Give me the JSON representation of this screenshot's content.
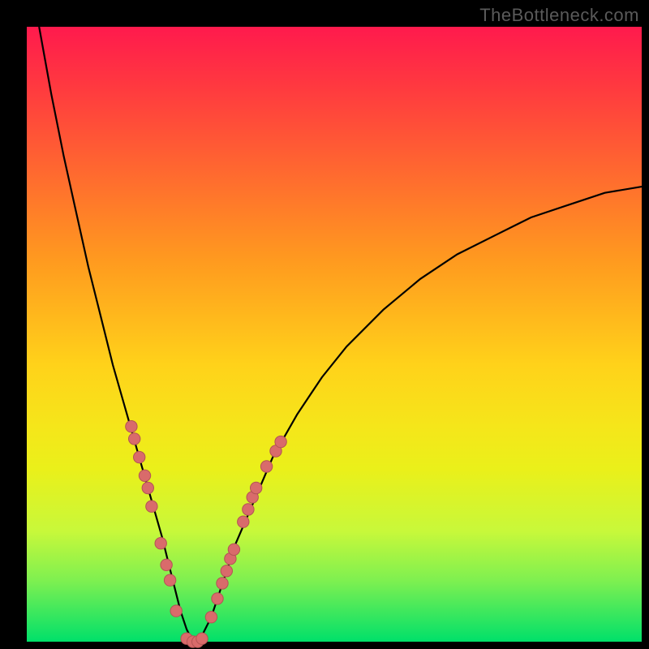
{
  "watermark": "TheBottleneck.com",
  "colors": {
    "curve": "#000000",
    "marker_fill": "#d96b6b",
    "marker_stroke": "#b35454",
    "bg_black": "#000000"
  },
  "chart_data": {
    "type": "line",
    "title": "",
    "xlabel": "",
    "ylabel": "",
    "xlim": [
      0,
      100
    ],
    "ylim": [
      0,
      100
    ],
    "series": [
      {
        "name": "bottleneck-curve",
        "x": [
          2,
          4,
          6,
          8,
          10,
          12,
          14,
          16,
          18,
          20,
          22,
          23,
          24,
          25,
          26,
          27,
          28,
          30,
          32,
          34,
          37,
          40,
          44,
          48,
          52,
          58,
          64,
          70,
          76,
          82,
          88,
          94,
          100
        ],
        "y": [
          100,
          89,
          79,
          70,
          61,
          53,
          45,
          38,
          31,
          24,
          17,
          13,
          9,
          5,
          2,
          0,
          0,
          4,
          10,
          16,
          23,
          30,
          37,
          43,
          48,
          54,
          59,
          63,
          66,
          69,
          71,
          73,
          74
        ]
      }
    ],
    "markers": {
      "name": "highlight-points",
      "points": [
        {
          "x": 17.0,
          "y": 35.0
        },
        {
          "x": 17.5,
          "y": 33.0
        },
        {
          "x": 18.3,
          "y": 30.0
        },
        {
          "x": 19.2,
          "y": 27.0
        },
        {
          "x": 19.7,
          "y": 25.0
        },
        {
          "x": 20.3,
          "y": 22.0
        },
        {
          "x": 21.8,
          "y": 16.0
        },
        {
          "x": 22.7,
          "y": 12.5
        },
        {
          "x": 23.3,
          "y": 10.0
        },
        {
          "x": 24.3,
          "y": 5.0
        },
        {
          "x": 26.0,
          "y": 0.5
        },
        {
          "x": 27.0,
          "y": 0.0
        },
        {
          "x": 27.8,
          "y": 0.0
        },
        {
          "x": 28.5,
          "y": 0.5
        },
        {
          "x": 30.0,
          "y": 4.0
        },
        {
          "x": 31.0,
          "y": 7.0
        },
        {
          "x": 31.8,
          "y": 9.5
        },
        {
          "x": 32.5,
          "y": 11.5
        },
        {
          "x": 33.1,
          "y": 13.5
        },
        {
          "x": 33.7,
          "y": 15.0
        },
        {
          "x": 35.2,
          "y": 19.5
        },
        {
          "x": 36.0,
          "y": 21.5
        },
        {
          "x": 36.7,
          "y": 23.5
        },
        {
          "x": 37.3,
          "y": 25.0
        },
        {
          "x": 39.0,
          "y": 28.5
        },
        {
          "x": 40.5,
          "y": 31.0
        },
        {
          "x": 41.3,
          "y": 32.5
        }
      ]
    }
  }
}
